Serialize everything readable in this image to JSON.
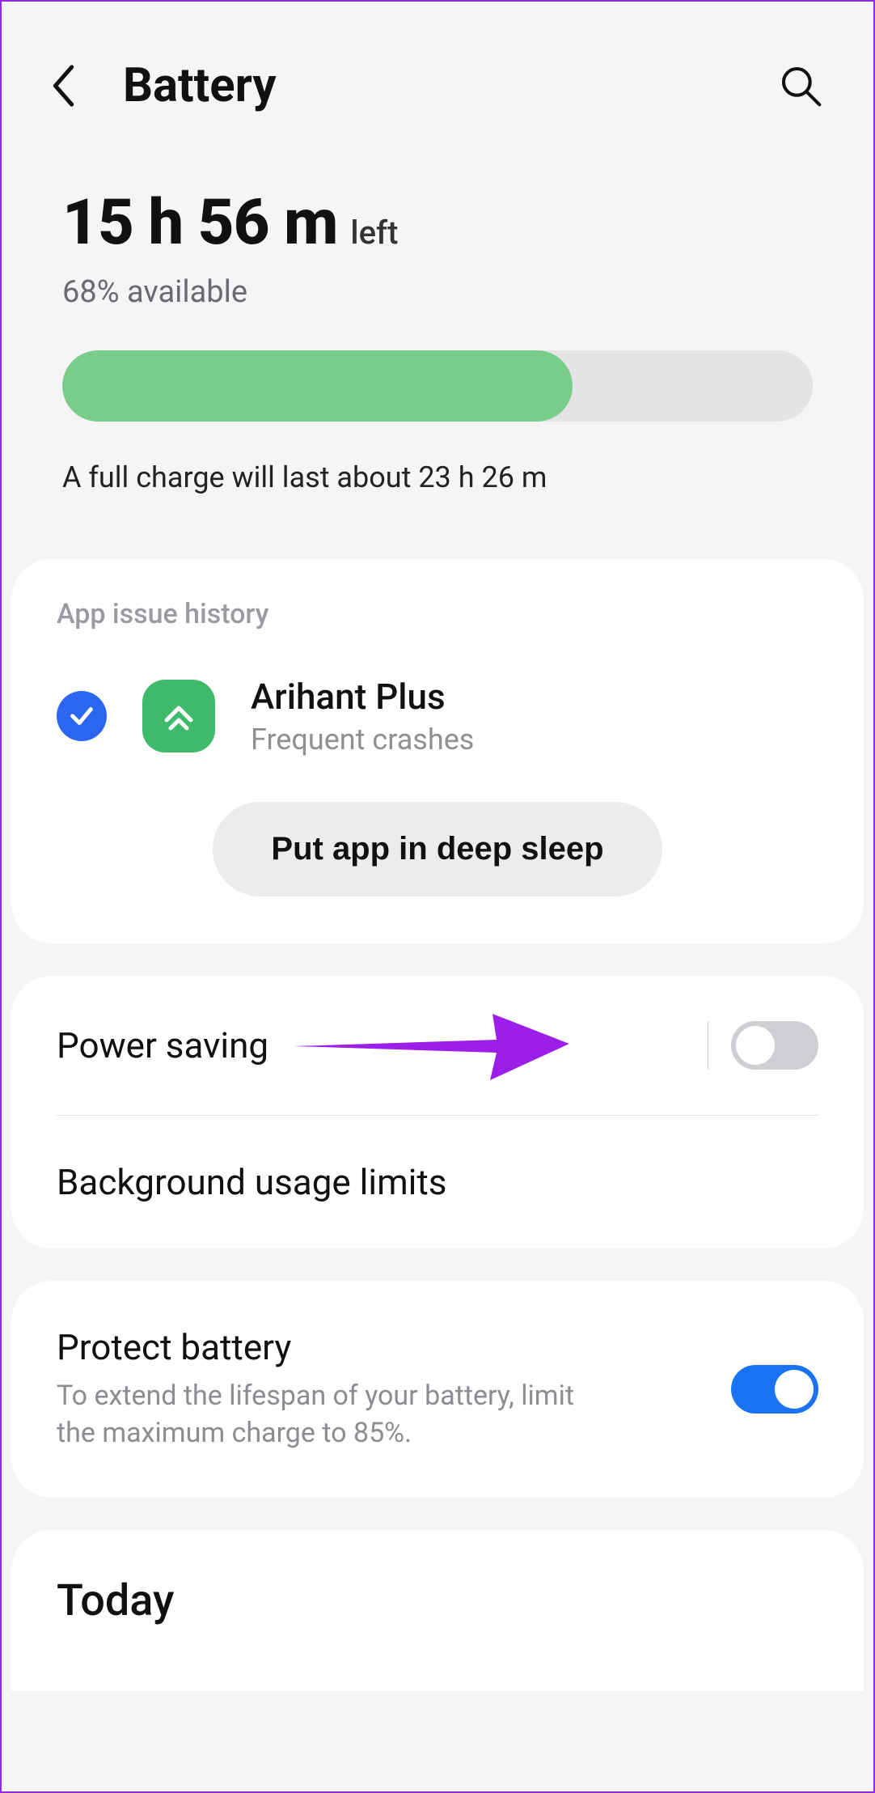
{
  "header": {
    "title": "Battery"
  },
  "summary": {
    "time_remaining": "15 h 56 m",
    "time_suffix": "left",
    "available": "68% available",
    "percent": 68,
    "full_charge_text": "A full charge will last about 23 h 26 m"
  },
  "app_issue": {
    "section_label": "App issue history",
    "app_name": "Arihant Plus",
    "issue_text": "Frequent crashes",
    "action_label": "Put app in deep sleep"
  },
  "settings": {
    "power_saving": {
      "label": "Power saving",
      "enabled": false
    },
    "background_limits": {
      "label": "Background usage limits"
    },
    "protect_battery": {
      "label": "Protect battery",
      "description": "To extend the lifespan of your battery, limit the maximum charge to 85%.",
      "enabled": true
    }
  },
  "today": {
    "title": "Today"
  },
  "colors": {
    "accent_blue": "#1a73f2",
    "bar_green": "#79cc8a",
    "annotation_purple": "#9b1fe8"
  }
}
